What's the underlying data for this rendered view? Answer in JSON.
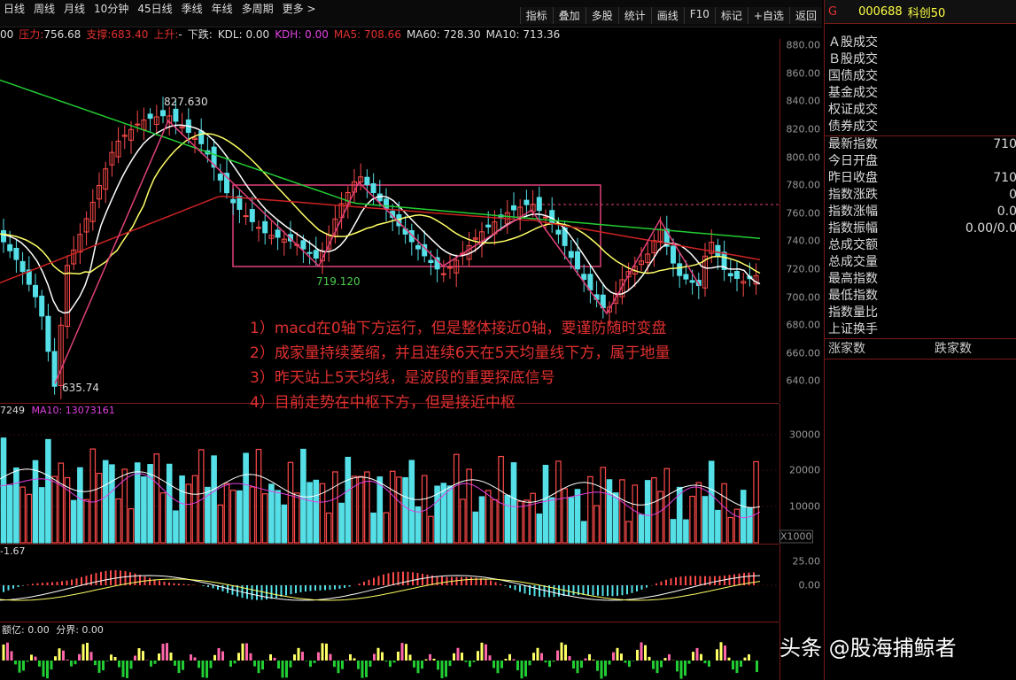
{
  "toolbar": {
    "periods": [
      "日线",
      "周线",
      "月线",
      "10分钟",
      "45日线",
      "季线",
      "年线",
      "多周期",
      "更多 >"
    ],
    "tools": [
      "指标",
      "叠加",
      "多股",
      "统计",
      "画线",
      "F10",
      "标记",
      "+自选",
      "返回"
    ]
  },
  "info_line": {
    "lead": "00",
    "pressure_label": "压力:",
    "pressure": "756.68",
    "support_label": "支撑:",
    "support": "683.40",
    "up": "上升:",
    "dash": "-",
    "down": "下跌:",
    "kdl": "KDL: 0.00",
    "kdh": "KDH: 0.00",
    "ma5": "MA5: 708.66",
    "ma60": "MA60: 728.30",
    "ma10": "MA10: 713.36"
  },
  "price_axis": [
    "880.00",
    "860.00",
    "840.00",
    "820.00",
    "800.00",
    "780.00",
    "760.00",
    "740.00",
    "720.00",
    "700.00",
    "680.00",
    "660.00",
    "640.00"
  ],
  "price_marks": {
    "high": "827.630",
    "low": "635.74",
    "mid_low": "719.120"
  },
  "volume_info": {
    "lead": "7249",
    "ma10": "MA10: 13073161"
  },
  "volume_axis": [
    "30000",
    "20000",
    "10000"
  ],
  "volume_unit": "X1000",
  "macd_info": "-1.67",
  "macd_axis": [
    "25.00",
    "0.00"
  ],
  "amount_info": {
    "amount": "额亿: 0.00",
    "split": "分界: 0.00"
  },
  "annotations": [
    "1）macd在0轴下方运行，但是整体接近0轴，要谨防随时变盘",
    "2）成家量持续萎缩，并且连续6天在5天均量线下方，属于地量",
    "3）昨天站上5天均线，是波段的重要探底信号",
    "4）目前走势在中枢下方，但是接近中枢"
  ],
  "right_panel": {
    "badge": "G",
    "code": "000688",
    "name": "科创50",
    "trades": [
      "Ａ股成交",
      "Ｂ股成交",
      "国债成交",
      "基金成交",
      "权证成交",
      "债券成交"
    ],
    "stats": [
      {
        "label": "最新指数",
        "value": "710"
      },
      {
        "label": "今日开盘",
        "value": ""
      },
      {
        "label": "昨日收盘",
        "value": "710"
      },
      {
        "label": "指数涨跌",
        "value": "0"
      },
      {
        "label": "指数涨幅",
        "value": "0.0"
      },
      {
        "label": "指数振幅",
        "value": "0.00/0.0"
      },
      {
        "label": "总成交额",
        "value": ""
      },
      {
        "label": "总成交量",
        "value": ""
      },
      {
        "label": "最高指数",
        "value": ""
      },
      {
        "label": "最低指数",
        "value": ""
      },
      {
        "label": "指数量比",
        "value": ""
      },
      {
        "label": "上证换手",
        "value": ""
      }
    ],
    "rise_label": "涨家数",
    "fall_label": "跌家数"
  },
  "watermark": "头条 @股海捕鲸者",
  "colors": {
    "up": "#ff4a4a",
    "down": "#55e0e8",
    "ma5": "#ffffff",
    "ma10": "#ffff66",
    "ma60": "#22cc33",
    "ma120": "#cc2222",
    "annotation": "#e03030",
    "box": "#e0407a"
  }
}
